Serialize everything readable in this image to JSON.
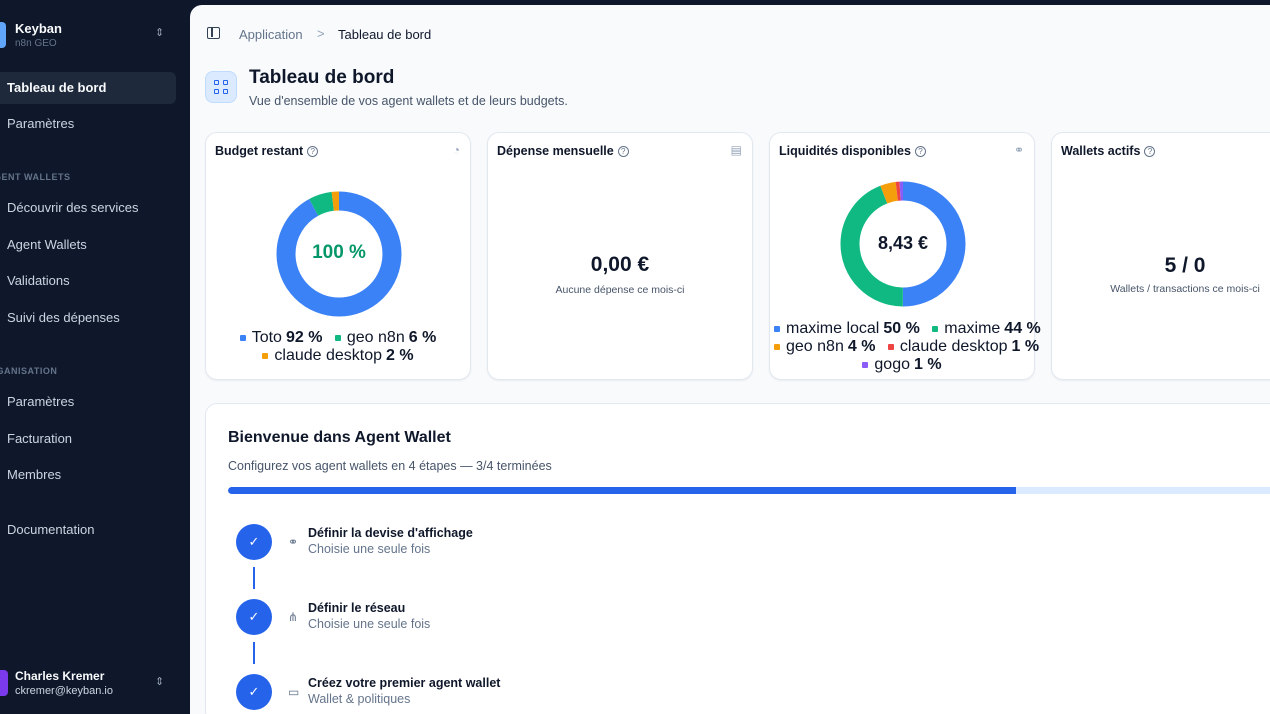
{
  "org": {
    "name": "Keyban",
    "subtitle": "n8n GEO"
  },
  "sidebar": {
    "main_items": [
      {
        "label": "Tableau de bord"
      },
      {
        "label": "Paramètres"
      }
    ],
    "section_wallets": "AGENT WALLETS",
    "wallet_items": [
      {
        "label": "Découvrir des services"
      },
      {
        "label": "Agent Wallets"
      },
      {
        "label": "Validations"
      },
      {
        "label": "Suivi des dépenses"
      }
    ],
    "section_org": "ORGANISATION",
    "org_items": [
      {
        "label": "Paramètres"
      },
      {
        "label": "Facturation"
      },
      {
        "label": "Membres"
      }
    ],
    "documentation": "Documentation"
  },
  "user": {
    "name": "Charles Kremer",
    "email": "ckremer@keyban.io"
  },
  "breadcrumb": {
    "parent": "Application",
    "separator": ">",
    "current": "Tableau de bord"
  },
  "page": {
    "title": "Tableau de bord",
    "subtitle": "Vue d'ensemble de vos agent wallets et de leurs budgets."
  },
  "cards": {
    "budget": {
      "title": "Budget restant",
      "center": "100 %",
      "legend": [
        {
          "name": "Toto",
          "pct": "92 %",
          "value": 92,
          "color": "#3b82f6"
        },
        {
          "name": "geo n8n",
          "pct": "6 %",
          "value": 6,
          "color": "#10b981"
        },
        {
          "name": "claude desktop",
          "pct": "2 %",
          "value": 2,
          "color": "#f59e0b"
        }
      ]
    },
    "monthly": {
      "title": "Dépense mensuelle",
      "value": "0,00 €",
      "caption": "Aucune dépense ce mois-ci"
    },
    "liquidity": {
      "title": "Liquidités disponibles",
      "center": "8,43 €",
      "legend": [
        {
          "name": "maxime local",
          "pct": "50 %",
          "value": 50,
          "color": "#3b82f6"
        },
        {
          "name": "maxime",
          "pct": "44 %",
          "value": 44,
          "color": "#10b981"
        },
        {
          "name": "geo n8n",
          "pct": "4 %",
          "value": 4,
          "color": "#f59e0b"
        },
        {
          "name": "claude desktop",
          "pct": "1 %",
          "value": 1,
          "color": "#ef4444"
        },
        {
          "name": "gogo",
          "pct": "1 %",
          "value": 1,
          "color": "#8b5cf6"
        }
      ]
    },
    "wallets": {
      "title": "Wallets actifs",
      "value": "5 / 0",
      "caption": "Wallets / transactions ce mois-ci"
    }
  },
  "welcome": {
    "title": "Bienvenue dans Agent Wallet",
    "subtitle": "Configurez vos agent wallets en 4 étapes — 3/4 terminées",
    "progress": 0.75,
    "steps": [
      {
        "title": "Définir la devise d'affichage",
        "subtitle": "Choisie une seule fois",
        "icon": "link-icon"
      },
      {
        "title": "Définir le réseau",
        "subtitle": "Choisie une seule fois",
        "icon": "network-icon"
      },
      {
        "title": "Créez votre premier agent wallet",
        "subtitle": "Wallet & politiques",
        "icon": "wallet-icon"
      }
    ]
  },
  "colors": {
    "accent": "#2563eb",
    "sidebar_bg": "#0f172a"
  }
}
